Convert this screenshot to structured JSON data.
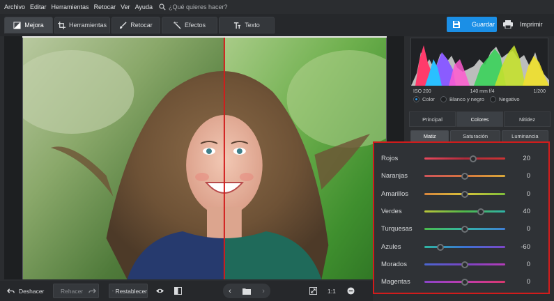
{
  "menu": {
    "items": [
      "Archivo",
      "Editar",
      "Herramientas",
      "Retocar",
      "Ver",
      "Ayuda"
    ],
    "search_placeholder": "¿Qué quieres hacer?"
  },
  "toolbar": {
    "tabs": [
      {
        "label": "Mejora",
        "icon": "enhance-icon",
        "active": true
      },
      {
        "label": "Herramientas",
        "icon": "crop-icon",
        "active": false
      },
      {
        "label": "Retocar",
        "icon": "brush-icon",
        "active": false
      },
      {
        "label": "Efectos",
        "icon": "magic-wand-icon",
        "active": false
      },
      {
        "label": "Texto",
        "icon": "text-icon",
        "active": false
      }
    ],
    "save_label": "Guardar",
    "print_label": "Imprimir",
    "accent_color": "#1b8fe6"
  },
  "histogram": {
    "iso": "ISO 200",
    "lens": "140 mm f/4",
    "shutter": "1/200"
  },
  "color_mode": {
    "options": [
      "Color",
      "Blanco y negro",
      "Negativo"
    ],
    "selected": "Color"
  },
  "panel_tabs": [
    "Principal",
    "Colores",
    "Nitidez"
  ],
  "panel_tab_active": "Colores",
  "sub_tabs": [
    "Matiz",
    "Saturación",
    "Luminancia"
  ],
  "sub_tab_active": "Matiz",
  "hue_sliders": [
    {
      "label": "Rojos",
      "value": "20",
      "level": 20,
      "gradient": [
        "#e8485c",
        "#b02a3a",
        "#cc3333"
      ]
    },
    {
      "label": "Naranjas",
      "value": "0",
      "level": 0,
      "gradient": [
        "#d0545a",
        "#d6763e",
        "#d9a83a"
      ]
    },
    {
      "label": "Amarillos",
      "value": "0",
      "level": 0,
      "gradient": [
        "#d8853c",
        "#d8c23a",
        "#7fbf3a"
      ]
    },
    {
      "label": "Verdes",
      "value": "40",
      "level": 40,
      "gradient": [
        "#b9c63a",
        "#4fb84a",
        "#2fb3a8"
      ]
    },
    {
      "label": "Turquesas",
      "value": "0",
      "level": 0,
      "gradient": [
        "#4bbb4c",
        "#32b5a6",
        "#3f7fd6"
      ]
    },
    {
      "label": "Azules",
      "value": "-60",
      "level": -60,
      "gradient": [
        "#2fb6a2",
        "#3b74d4",
        "#7d46c8"
      ]
    },
    {
      "label": "Morados",
      "value": "0",
      "level": 0,
      "gradient": [
        "#4a66d0",
        "#7b44c6",
        "#b43cb8"
      ]
    },
    {
      "label": "Magentas",
      "value": "0",
      "level": 0,
      "gradient": [
        "#8a44c8",
        "#c03cae",
        "#d8386e"
      ]
    }
  ],
  "bottom": {
    "undo_label": "Deshacer",
    "redo_label": "Rehacer",
    "reset_label": "Restablecer",
    "zoom_label": "1:1"
  }
}
